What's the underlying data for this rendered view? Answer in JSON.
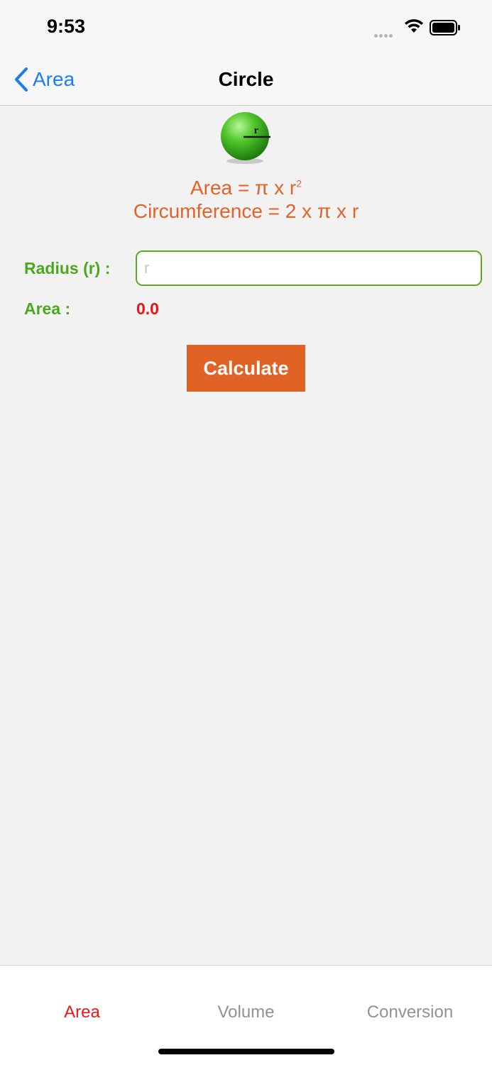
{
  "status_bar": {
    "time": "9:53",
    "signal_icon": "signal-dots-icon",
    "wifi_icon": "wifi-icon",
    "battery_icon": "battery-icon"
  },
  "nav": {
    "back_label": "Area",
    "back_icon": "chevron-left-icon",
    "title": "Circle"
  },
  "illustration": {
    "ball_label": "r",
    "formula_area_prefix": "Area = π x r",
    "formula_area_exponent": "2",
    "formula_circumference": "Circumference = 2 x π x r"
  },
  "form": {
    "radius_label": "Radius (r) :",
    "radius_placeholder": "r",
    "radius_value": "",
    "area_label": "Area :",
    "area_value": "0.0",
    "calculate_label": "Calculate"
  },
  "tabs": [
    {
      "label": "Area",
      "selected": true
    },
    {
      "label": "Volume",
      "selected": false
    },
    {
      "label": "Conversion",
      "selected": false
    }
  ],
  "colors": {
    "accent": "#e06225",
    "label_green": "#4ba81e",
    "result_red": "#e8141a",
    "ios_blue": "#1a7ef2",
    "tab_selected": "#f0141a",
    "tab_unselected": "#929292"
  }
}
